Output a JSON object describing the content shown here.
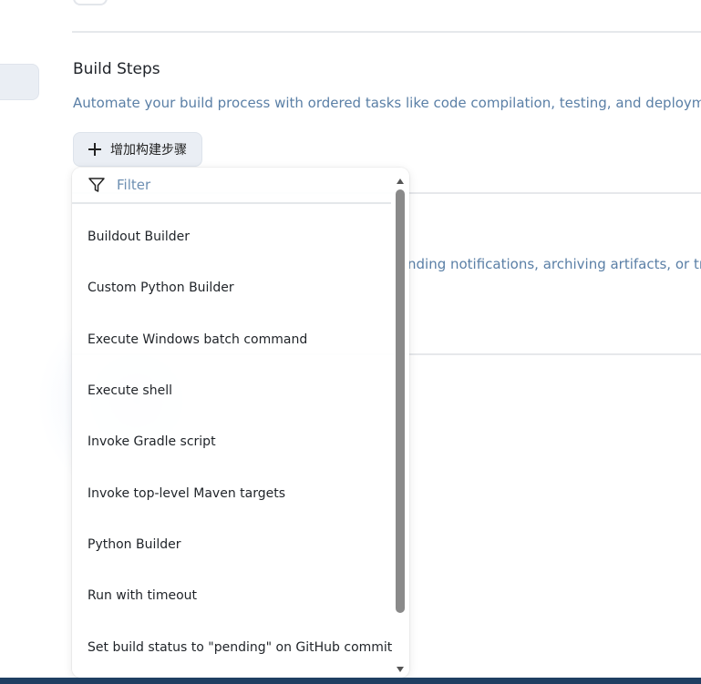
{
  "section": {
    "title": "Build Steps",
    "description": "Automate your build process with ordered tasks like code compilation, testing, and deployment."
  },
  "post_build": {
    "description_partial": "nding notifications, archiving artifacts, or trigg"
  },
  "add_step_button": {
    "label": "增加构建步骤",
    "icon": "plus-icon"
  },
  "dropdown": {
    "filter_placeholder": "Filter",
    "filter_value": "",
    "filter_icon": "filter-icon",
    "options": [
      "Buildout Builder",
      "Custom Python Builder",
      "Execute Windows batch command",
      "Execute shell",
      "Invoke Gradle script",
      "Invoke top-level Maven targets",
      "Python Builder",
      "Run with timeout",
      "Set build status to \"pending\" on GitHub commit"
    ]
  },
  "colors": {
    "accent_text": "#5a7fa6",
    "button_bg": "#eaeef4",
    "taskbar": "#1f3f62"
  }
}
